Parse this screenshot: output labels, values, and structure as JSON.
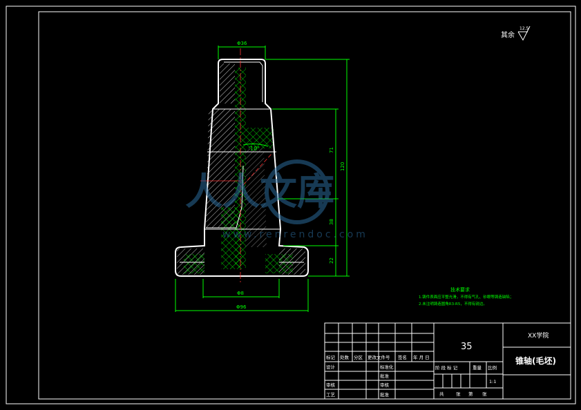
{
  "roughness": {
    "label": "其余",
    "symbol_text": "12.5"
  },
  "title_block": {
    "material": "35",
    "school": "XX学院",
    "part_name": "锥轴(毛坯)",
    "header_row": [
      "标记",
      "处数",
      "分区",
      "更改文件号",
      "签名",
      "年 月 日"
    ],
    "left_rows": [
      "设计",
      "审核",
      "工艺"
    ],
    "mid_rows": [
      "标准化",
      "批准",
      "审核",
      "批准"
    ],
    "stage_labels": [
      "阶 段 标 记",
      "重量",
      "比例"
    ],
    "scale": "1:1",
    "sheet": [
      "共",
      "张",
      "第",
      "张"
    ]
  },
  "tech_req": {
    "title": "技术要求",
    "lines": [
      "1.铸件表面应平整光滑，不得有气孔、砂眼等铸造缺陷；",
      "2.未注明铸造圆角R3-R5，不得有锐边。"
    ]
  },
  "dims": {
    "top_width": "Φ36",
    "bottom_width": "Φ96",
    "bore": "Φ8",
    "angle": "10°",
    "h_total": "120",
    "h_mid": "71",
    "h_lower": "38",
    "h_base": "22"
  },
  "watermark": {
    "brand": "人人文库",
    "url": "www.renrendoc.com"
  },
  "colors": {
    "line": "#ffffff",
    "dim": "#00ff00",
    "tech": "#00ff00",
    "hatch": "#ffffff"
  }
}
